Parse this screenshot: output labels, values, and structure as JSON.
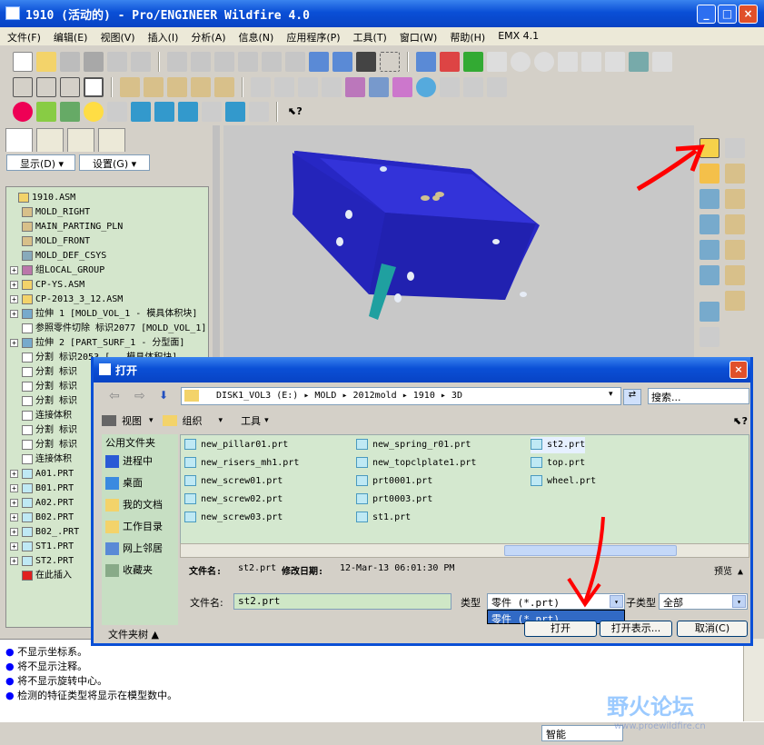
{
  "window": {
    "title": "1910 (活动的) - Pro/ENGINEER Wildfire 4.0",
    "min": "_",
    "max": "□",
    "close": "×"
  },
  "menu": [
    "文件(F)",
    "编辑(E)",
    "视图(V)",
    "插入(I)",
    "分析(A)",
    "信息(N)",
    "应用程序(P)",
    "工具(T)",
    "窗口(W)",
    "帮助(H)",
    "EMX 4.1"
  ],
  "panel": {
    "show_label": "显示(D) ▾",
    "settings_label": "设置(G) ▾"
  },
  "tree": [
    {
      "label": "1910.ASM",
      "indent": 0,
      "exp": "",
      "icon": "asm"
    },
    {
      "label": "MOLD_RIGHT",
      "indent": 1,
      "exp": "",
      "icon": "plane"
    },
    {
      "label": "MAIN_PARTING_PLN",
      "indent": 1,
      "exp": "",
      "icon": "plane"
    },
    {
      "label": "MOLD_FRONT",
      "indent": 1,
      "exp": "",
      "icon": "plane"
    },
    {
      "label": "MOLD_DEF_CSYS",
      "indent": 1,
      "exp": "",
      "icon": "csys"
    },
    {
      "label": "组LOCAL_GROUP",
      "indent": 1,
      "exp": "+",
      "icon": "group"
    },
    {
      "label": "CP-YS.ASM",
      "indent": 1,
      "exp": "+",
      "icon": "asm"
    },
    {
      "label": "CP-2013_3_12.ASM",
      "indent": 1,
      "exp": "+",
      "icon": "asm"
    },
    {
      "label": "拉伸 1 [MOLD_VOL_1 - 模具体积块]",
      "indent": 1,
      "exp": "+",
      "icon": "extrude"
    },
    {
      "label": "参照零件切除 标识2077 [MOLD_VOL_1]",
      "indent": 1,
      "exp": "",
      "icon": "feat"
    },
    {
      "label": "拉伸 2 [PART_SURF_1 - 分型面]",
      "indent": 1,
      "exp": "+",
      "icon": "extrude"
    },
    {
      "label": "分割 标识2053 [...模具体积块]",
      "indent": 1,
      "exp": "",
      "icon": "feat"
    },
    {
      "label": "分割 标识",
      "indent": 1,
      "exp": "",
      "icon": "feat"
    },
    {
      "label": "分割 标识",
      "indent": 1,
      "exp": "",
      "icon": "feat"
    },
    {
      "label": "分割 标识",
      "indent": 1,
      "exp": "",
      "icon": "feat"
    },
    {
      "label": "连接体积",
      "indent": 1,
      "exp": "",
      "icon": "feat"
    },
    {
      "label": "分割 标识",
      "indent": 1,
      "exp": "",
      "icon": "feat"
    },
    {
      "label": "分割 标识",
      "indent": 1,
      "exp": "",
      "icon": "feat"
    },
    {
      "label": "连接体积",
      "indent": 1,
      "exp": "",
      "icon": "feat"
    },
    {
      "label": "A01.PRT",
      "indent": 1,
      "exp": "+",
      "icon": "prt"
    },
    {
      "label": "B01.PRT",
      "indent": 1,
      "exp": "+",
      "icon": "prt"
    },
    {
      "label": "A02.PRT",
      "indent": 1,
      "exp": "+",
      "icon": "prt"
    },
    {
      "label": "B02.PRT",
      "indent": 1,
      "exp": "+",
      "icon": "prt"
    },
    {
      "label": "B02_.PRT",
      "indent": 1,
      "exp": "+",
      "icon": "prt"
    },
    {
      "label": "ST1.PRT",
      "indent": 1,
      "exp": "+",
      "icon": "prt"
    },
    {
      "label": "ST2.PRT",
      "indent": 1,
      "exp": "+",
      "icon": "prt"
    },
    {
      "label": "在此插入",
      "indent": 1,
      "exp": "",
      "icon": "insert"
    }
  ],
  "messages": [
    "不显示坐标系。",
    "将不显示注释。",
    "将不显示旋转中心。",
    "检测的特征类型将显示在模型数中。"
  ],
  "status": {
    "smart": "智能"
  },
  "watermark": {
    "text": "野火论坛",
    "url": "www.proewildfire.cn"
  },
  "dialog": {
    "title": "打开",
    "path": [
      "DISK1_VOL3 (E:)",
      "MOLD",
      "2012mold",
      "1910",
      "3D"
    ],
    "search_placeholder": "搜索...",
    "toolbar": {
      "view": "视图",
      "organize": "组织",
      "tools": "工具"
    },
    "places_header": "公用文件夹",
    "places": [
      "进程中",
      "桌面",
      "我的文档",
      "工作目录",
      "网上邻居",
      "收藏夹"
    ],
    "files_col1": [
      "new_pillar01.prt",
      "new_risers_mh1.prt",
      "new_screw01.prt",
      "new_screw02.prt",
      "new_screw03.prt"
    ],
    "files_col2": [
      "new_spring_r01.prt",
      "new_topclplate1.prt",
      "prt0001.prt",
      "prt0003.prt",
      "st1.prt"
    ],
    "files_col3": [
      "st2.prt",
      "top.prt",
      "wheel.prt"
    ],
    "selected_file": "st2.prt",
    "info": {
      "name_label": "文件名:",
      "name_value": "st2.prt",
      "date_label": "修改日期:",
      "date_value": "12-Mar-13 06:01:30 PM",
      "preview": "预览 ▲"
    },
    "filename_label": "文件名:",
    "filename_value": "st2.prt",
    "type_label": "类型",
    "type_value": "零件 (*.prt)",
    "type_option": "零件 (*.prt)",
    "subtype_label": "子类型",
    "subtype_value": "全部",
    "folder_tree": "文件夹树 ▲",
    "open_btn": "打开",
    "open_show_btn": "打开表示...",
    "cancel_btn": "取消(C)"
  },
  "colors": {
    "xp_blue": "#0a4fd6",
    "model": "#2b2bc6",
    "tree_bg": "#d4e6cc",
    "annotation_red": "#ff0000"
  }
}
